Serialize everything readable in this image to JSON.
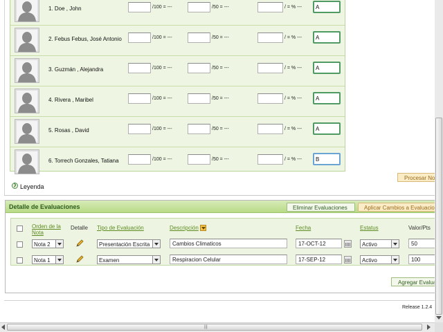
{
  "students": [
    {
      "name": "1. Doe , John",
      "grade": "A"
    },
    {
      "name": "2. Febus Febus, José Antonio",
      "grade": "A"
    },
    {
      "name": "3. Guzmán , Alejandra",
      "grade": "A"
    },
    {
      "name": "4. Rivera , Maribel",
      "grade": "A"
    },
    {
      "name": "5. Rosas , David",
      "grade": "A"
    },
    {
      "name": "6. Torrech Gonzales, Tatiana",
      "grade": "B"
    }
  ],
  "score_labels": {
    "of100": "/100 = ---",
    "of50": "/50 = ---",
    "percent": "/ = % ---"
  },
  "buttons": {
    "procesar": "Procesar Notas",
    "eliminar": "Eliminar Evaluaciones",
    "aplicar": "Aplicar Cambios a Evaluaciones",
    "agregar": "Agregar Evaluación"
  },
  "leyenda": "Leyenda",
  "detalle": {
    "title": "Detalle de Evaluaciones",
    "headers": {
      "orden": "Orden de la Nota",
      "detalle": "Detalle",
      "tipo": "Tipo de Evaluación",
      "descripcion": "Descripción",
      "fecha": "Fecha",
      "estatus": "Estatus",
      "valor": "Valor/Pts"
    },
    "rows": [
      {
        "orden": "Nota 2",
        "tipo": "Presentación Escrita",
        "descripcion": "Cambios Climaticos",
        "fecha": "17-OCT-12",
        "estatus": "Activo",
        "valor": "50"
      },
      {
        "orden": "Nota 1",
        "tipo": "Examen",
        "descripcion": "Respiracion Celular",
        "fecha": "17-SEP-12",
        "estatus": "Activo",
        "valor": "100"
      }
    ]
  },
  "release": "Release 1.2.4",
  "scrollbar_grip": "|||",
  "icons": {
    "avatar": "user-silhouette-icon",
    "pencil": "pencil-icon",
    "calendar": "calendar-icon"
  },
  "colors": {
    "accent_green": "#5c8a1f",
    "row_bg": "#eef6e3",
    "orange_button": "#fbecc8"
  }
}
